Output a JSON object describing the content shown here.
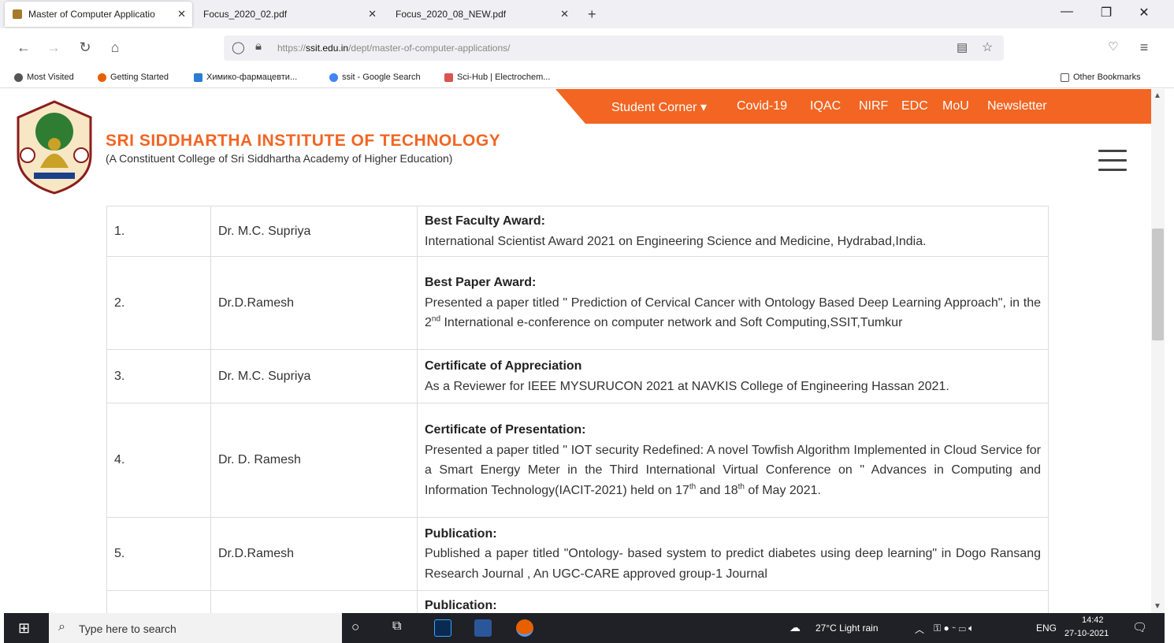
{
  "browser": {
    "tabs": [
      {
        "title": "Master of Computer Applicatio",
        "active": true
      },
      {
        "title": "Focus_2020_02.pdf",
        "active": false
      },
      {
        "title": "Focus_2020_08_NEW.pdf",
        "active": false
      }
    ],
    "new_tab": "+",
    "url_prefix": "https://",
    "url_domain": "ssit.edu.in",
    "url_path": "/dept/master-of-computer-applications/",
    "bookmarks": [
      {
        "label": "Most Visited",
        "color": "#555555"
      },
      {
        "label": "Getting Started",
        "color": "#e66000"
      },
      {
        "label": "Химико-фармацевти...",
        "color": "#2b7cd3"
      },
      {
        "label": "ssit - Google Search",
        "color": "#4285f4"
      },
      {
        "label": "Sci-Hub | Electrochem...",
        "color": "#d9534f"
      }
    ],
    "other_bookmarks": "Other Bookmarks"
  },
  "site": {
    "menu": [
      "Student Corner ▾",
      "Covid-19",
      "IQAC",
      "NIRF",
      "EDC",
      "MoU",
      "Newsletter"
    ],
    "name": "SRI SIDDHARTHA INSTITUTE OF TECHNOLOGY",
    "subtitle": "(A Constituent College of Sri Siddhartha Academy of Higher Education)",
    "accent": "#f26522"
  },
  "awards": [
    {
      "no": "1.",
      "name": "Dr. M.C. Supriya",
      "heading": "Best Faculty Award:",
      "text": "International Scientist Award 2021 on Engineering Science and Medicine, Hydrabad,India."
    },
    {
      "no": "2.",
      "name": "Dr.D.Ramesh",
      "heading": "Best Paper Award:",
      "text_a": "Presented a paper titled \" Prediction of Cervical Cancer with Ontology Based Deep Learning Approach\", in the 2",
      "sup": "nd",
      "text_b": " International e-conference on computer network and Soft Computing,SSIT,Tumkur"
    },
    {
      "no": "3.",
      "name": "Dr. M.C. Supriya",
      "heading": "Certificate of Appreciation",
      "text": "As a Reviewer for IEEE MYSURUCON 2021 at NAVKIS College of Engineering Hassan 2021."
    },
    {
      "no": "4.",
      "name": "Dr. D. Ramesh",
      "heading": "Certificate of Presentation:",
      "text_a": "Presented a paper titled \" IOT security Redefined: A novel Towfish Algorithm Implemented in Cloud Service for a Smart Energy Meter in the Third International Virtual Conference on \" Advances in Computing and Information Technology(IACIT-2021) held on 17",
      "sup1": "th",
      "text_b": " and 18",
      "sup2": "th",
      "text_c": " of May 2021."
    },
    {
      "no": "5.",
      "name": "Dr.D.Ramesh",
      "heading": "Publication:",
      "text": "Published a paper titled \"Ontology- based system to predict diabetes using deep learning\" in Dogo Ransang Research Journal , An UGC-CARE approved group-1 Journal"
    },
    {
      "no": "",
      "name": "",
      "heading": "Publication:",
      "text": ""
    }
  ],
  "taskbar": {
    "search_placeholder": "Type here to search",
    "weather": "27°C  Light rain",
    "lang": "ENG",
    "time": "14:42",
    "date": "27-10-2021"
  }
}
